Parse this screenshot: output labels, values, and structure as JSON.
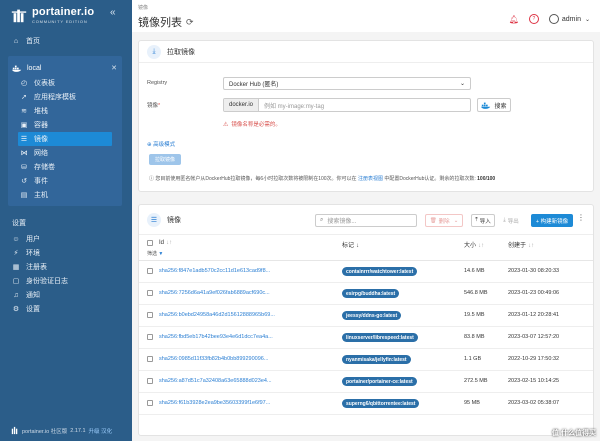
{
  "app": {
    "logo_title": "portainer.io",
    "logo_subtitle": "COMMUNITY EDITION",
    "collapse_icon": "double-chevron-left-icon"
  },
  "sidebar": {
    "home_label": "首页",
    "environment_name": "local",
    "env_items": [
      {
        "label": "仪表板",
        "icon": "dashboard-icon"
      },
      {
        "label": "应用程序模板",
        "icon": "rocket-icon"
      },
      {
        "label": "堆栈",
        "icon": "layers-icon"
      },
      {
        "label": "容器",
        "icon": "box-icon"
      },
      {
        "label": "镜像",
        "icon": "list-icon",
        "active": true
      },
      {
        "label": "网络",
        "icon": "network-icon"
      },
      {
        "label": "存储卷",
        "icon": "database-icon"
      },
      {
        "label": "事件",
        "icon": "history-icon"
      },
      {
        "label": "主机",
        "icon": "server-icon"
      }
    ],
    "settings_label": "设置",
    "settings_items": [
      {
        "label": "用户",
        "icon": "user-icon"
      },
      {
        "label": "环境",
        "icon": "plug-icon"
      },
      {
        "label": "注册表",
        "icon": "registry-icon"
      },
      {
        "label": "身份验证日志",
        "icon": "log-icon"
      },
      {
        "label": "通知",
        "icon": "bell-icon"
      },
      {
        "label": "设置",
        "icon": "gear-icon"
      }
    ],
    "footer_brand": "portainer.io 社区版",
    "footer_version": "2.17.1",
    "footer_upgrade": "升级 汉化"
  },
  "topbar": {
    "breadcrumb": "镜像",
    "title": "镜像列表",
    "user": "admin"
  },
  "pull": {
    "title": "拉取镜像",
    "registry_label": "Registry",
    "registry_value": "Docker Hub (匿名)",
    "image_label": "镜像",
    "image_prefix": "docker.io",
    "image_placeholder": "例如 my-image:my-tag",
    "search_button": "搜索",
    "error": "镜像名称是必需的。",
    "advanced_mode": "高级模式",
    "pull_button": "拉取镜像",
    "info_text": "您目前使用匿名帐户从DockerHub拉取镜像，每6小时拉取次数将被限制在100次。你可以在 ",
    "info_link": "注册表视图",
    "info_text2": " 中配置DockerHub认证。剩余的拉取次数: ",
    "remaining": "100/100"
  },
  "list": {
    "title": "镜像",
    "search_placeholder": "搜索镜像...",
    "delete_label": "删除",
    "import_label": "导入",
    "export_label": "导出",
    "build_label": "+ 构建新镜像",
    "col_id": "Id",
    "col_filter": "筛选",
    "col_tags": "标记",
    "col_size": "大小",
    "col_created": "创建于",
    "rows": [
      {
        "id": "sha256:f847e1adb570c2cc11d1e613cad9f8...",
        "tag": "containrrr/watchtower:latest",
        "size": "14.6 MB",
        "created": "2023-01-30 08:20:33"
      },
      {
        "id": "sha256:7256d6a41a9ef026fab6889acf690c...",
        "tag": "esirpg/buddha:latest",
        "size": "546.8 MB",
        "created": "2023-01-23 00:49:06"
      },
      {
        "id": "sha256:b0ebd24958a46d2d15612888965b69...",
        "tag": "jeessy/ddns-go:latest",
        "size": "19.5 MB",
        "created": "2023-01-12 20:28:41"
      },
      {
        "id": "sha256:fbd5eb17b42bee93e4e6d1dcc7ea4a...",
        "tag": "linuxserver/librespeed:latest",
        "size": "83.8 MB",
        "created": "2023-03-07 12:57:20"
      },
      {
        "id": "sha256:0985d11f33fb82b4b0bb899290096...",
        "tag": "nyanmisaka/jellyfin:latest",
        "size": "1.1 GB",
        "created": "2022-10-29 17:50:32"
      },
      {
        "id": "sha256:a87d51c7a32408a63e65888d023e4...",
        "tag": "portainer/portainer-ce:latest",
        "size": "272.5 MB",
        "created": "2023-02-15 10:14:25"
      },
      {
        "id": "sha256:f61b3928e2ea9be35603399f1e6f97...",
        "tag": "superng6/qbittorrentee:latest",
        "size": "95 MB",
        "created": "2023-03-02 05:38:07"
      }
    ]
  },
  "watermark": "值 什么值得买",
  "colors": {
    "sidebar_bg": "#2b5d89",
    "active_item": "#1d8ad6",
    "link": "#2b7fd3",
    "tag_badge": "#2b6fa8",
    "error": "#d9534f"
  }
}
